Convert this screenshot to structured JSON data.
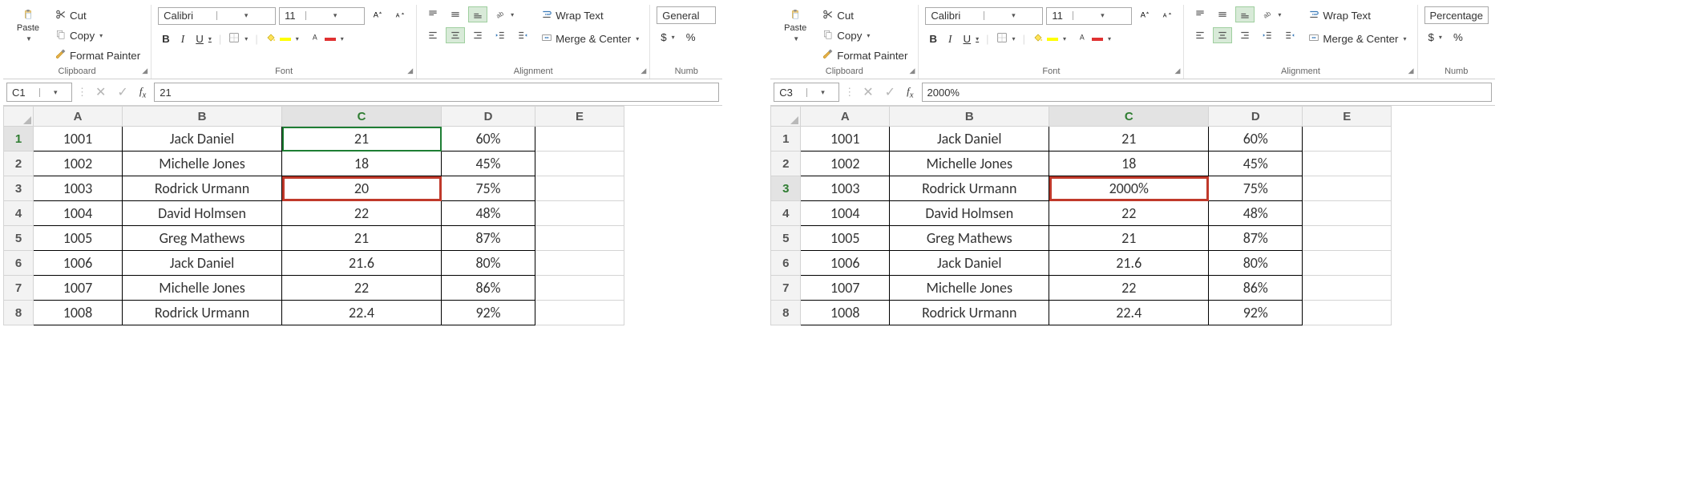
{
  "clip": {
    "paste": "Paste",
    "cut": "Cut",
    "copy": "Copy",
    "fmt": "Format Painter",
    "label": "Clipboard"
  },
  "font": {
    "name": "Calibri",
    "size": "11",
    "label": "Font",
    "bold": "B",
    "italic": "I",
    "underline": "U"
  },
  "align": {
    "wrap": "Wrap Text",
    "merge": "Merge & Center",
    "label": "Alignment"
  },
  "num": {
    "label": "Numb",
    "dollar": "$",
    "pct": "%"
  },
  "fmtGeneral": "General",
  "fmtPercentage": "Percentage",
  "fx": {
    "left": {
      "cell": "C1",
      "value": "21"
    },
    "right": {
      "cell": "C3",
      "value": "2000%"
    }
  },
  "cols": [
    "A",
    "B",
    "C",
    "D",
    "E"
  ],
  "leftGrid": {
    "activeRow": 1,
    "activeCol": "C",
    "boxRow": 3,
    "boxCol": "C",
    "rows": [
      {
        "n": 1,
        "A": "1001",
        "B": "Jack Daniel",
        "C": "21",
        "D": "60%"
      },
      {
        "n": 2,
        "A": "1002",
        "B": "Michelle Jones",
        "C": "18",
        "D": "45%"
      },
      {
        "n": 3,
        "A": "1003",
        "B": "Rodrick Urmann",
        "C": "20",
        "D": "75%"
      },
      {
        "n": 4,
        "A": "1004",
        "B": "David Holmsen",
        "C": "22",
        "D": "48%"
      },
      {
        "n": 5,
        "A": "1005",
        "B": "Greg Mathews",
        "C": "21",
        "D": "87%"
      },
      {
        "n": 6,
        "A": "1006",
        "B": "Jack Daniel",
        "C": "21.6",
        "D": "80%"
      },
      {
        "n": 7,
        "A": "1007",
        "B": "Michelle Jones",
        "C": "22",
        "D": "86%"
      },
      {
        "n": 8,
        "A": "1008",
        "B": "Rodrick Urmann",
        "C": "22.4",
        "D": "92%"
      }
    ]
  },
  "rightGrid": {
    "activeRow": 3,
    "activeCol": "C",
    "boxRow": 3,
    "boxCol": "C",
    "rows": [
      {
        "n": 1,
        "A": "1001",
        "B": "Jack Daniel",
        "C": "21",
        "D": "60%"
      },
      {
        "n": 2,
        "A": "1002",
        "B": "Michelle Jones",
        "C": "18",
        "D": "45%"
      },
      {
        "n": 3,
        "A": "1003",
        "B": "Rodrick Urmann",
        "C": "2000%",
        "D": "75%"
      },
      {
        "n": 4,
        "A": "1004",
        "B": "David Holmsen",
        "C": "22",
        "D": "48%"
      },
      {
        "n": 5,
        "A": "1005",
        "B": "Greg Mathews",
        "C": "21",
        "D": "87%"
      },
      {
        "n": 6,
        "A": "1006",
        "B": "Jack Daniel",
        "C": "21.6",
        "D": "80%"
      },
      {
        "n": 7,
        "A": "1007",
        "B": "Michelle Jones",
        "C": "22",
        "D": "86%"
      },
      {
        "n": 8,
        "A": "1008",
        "B": "Rodrick Urmann",
        "C": "22.4",
        "D": "92%"
      }
    ]
  }
}
